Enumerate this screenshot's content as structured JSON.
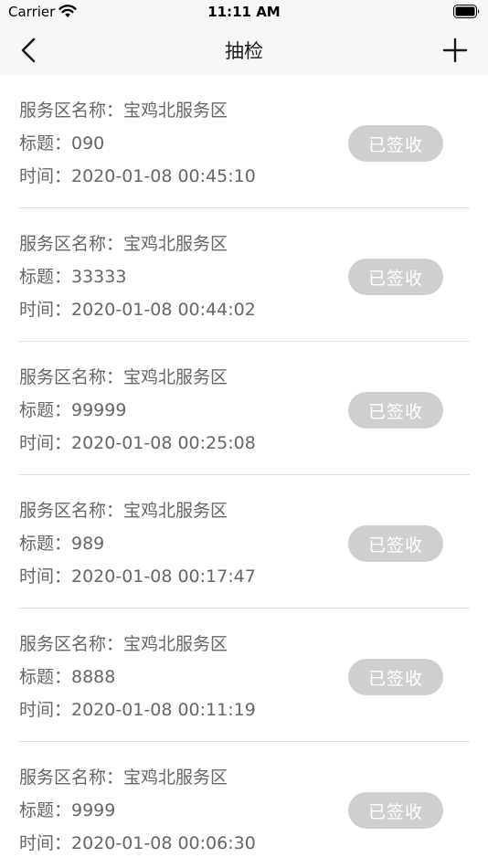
{
  "status_bar": {
    "carrier": "Carrier",
    "time": "11:11 AM"
  },
  "nav": {
    "title": "抽检",
    "back_icon": "chevron-left-icon",
    "add_icon": "plus-icon"
  },
  "colors": {
    "bar_background": "#f7f7f7",
    "text_gray": "#666666",
    "button_gray": "#cfcfcf",
    "divider": "#e2e2e2"
  },
  "items": [
    {
      "service_area": "服务区名称：宝鸡北服务区",
      "title": "标题：090",
      "time": "时间：2020-01-08 00:45:10",
      "status": "已签收"
    },
    {
      "service_area": "服务区名称：宝鸡北服务区",
      "title": "标题：33333",
      "time": "时间：2020-01-08 00:44:02",
      "status": "已签收"
    },
    {
      "service_area": "服务区名称：宝鸡北服务区",
      "title": "标题：99999",
      "time": "时间：2020-01-08 00:25:08",
      "status": "已签收"
    },
    {
      "service_area": "服务区名称：宝鸡北服务区",
      "title": "标题：989",
      "time": "时间：2020-01-08 00:17:47",
      "status": "已签收"
    },
    {
      "service_area": "服务区名称：宝鸡北服务区",
      "title": "标题：8888",
      "time": "时间：2020-01-08 00:11:19",
      "status": "已签收"
    },
    {
      "service_area": "服务区名称：宝鸡北服务区",
      "title": "标题：9999",
      "time": "时间：2020-01-08 00:06:30",
      "status": "已签收"
    }
  ]
}
